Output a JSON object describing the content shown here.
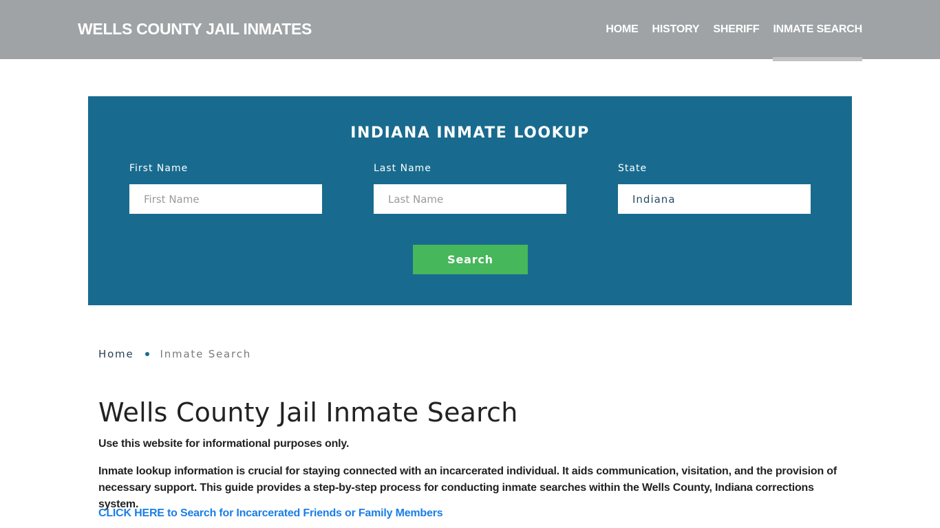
{
  "header": {
    "brand": "WELLS COUNTY JAIL INMATES",
    "nav": [
      {
        "label": "HOME",
        "active": false
      },
      {
        "label": "HISTORY",
        "active": false
      },
      {
        "label": "SHERIFF",
        "active": false
      },
      {
        "label": "INMATE SEARCH",
        "active": true
      }
    ]
  },
  "lookup": {
    "title": "INDIANA INMATE LOOKUP",
    "first_name": {
      "label": "First Name",
      "placeholder": "First Name",
      "value": ""
    },
    "last_name": {
      "label": "Last Name",
      "placeholder": "Last Name",
      "value": ""
    },
    "state": {
      "label": "State",
      "value": "Indiana"
    },
    "search_label": "Search"
  },
  "breadcrumb": {
    "home": "Home",
    "current": "Inmate Search"
  },
  "main": {
    "title": "Wells County Jail Inmate Search",
    "disclaimer": "Use this website for informational purposes only.",
    "intro": "Inmate lookup information is crucial for staying connected with an incarcerated individual. It aids communication, visitation, and the provision of necessary support. This guide provides a step-by-step process for conducting inmate searches within the Wells County, Indiana corrections system.",
    "cta_link": "CLICK HERE to Search for Incarcerated Friends or Family Members"
  },
  "colors": {
    "header_bg": "#9fa3a6",
    "lookup_bg": "#186b8e",
    "search_button": "#46b75a",
    "link": "#1a7ee6"
  }
}
